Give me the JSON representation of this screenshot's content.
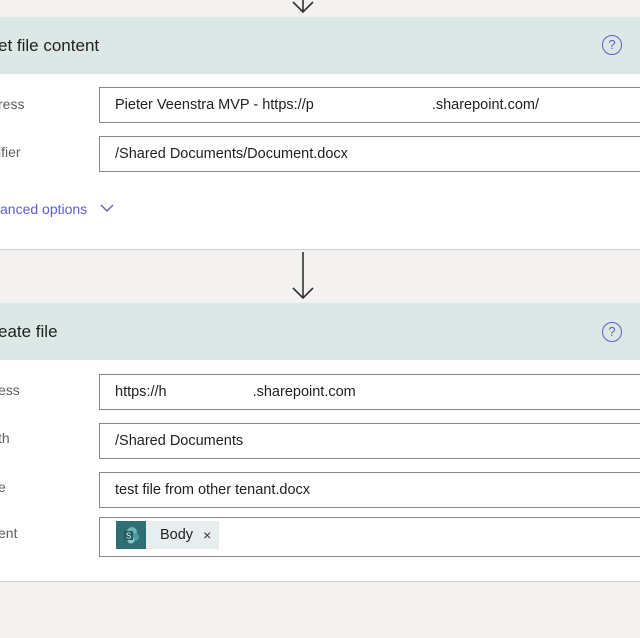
{
  "card1": {
    "title": "et file content",
    "help_glyph": "?",
    "fields": [
      {
        "label": "ress",
        "value_start": "Pieter Veenstra MVP - https://p",
        "value_end": ".sharepoint.com/"
      },
      {
        "label": "ifier",
        "value": "/Shared Documents/Document.docx"
      }
    ],
    "advanced_label": "anced options"
  },
  "card2": {
    "title": "eate file",
    "help_glyph": "?",
    "fields": [
      {
        "label": "ess",
        "value_start": "https://h",
        "value_end": ".sharepoint.com"
      },
      {
        "label": "th",
        "value": "/Shared Documents"
      },
      {
        "label": "e",
        "value": "test file from other tenant.docx"
      },
      {
        "label": "ent",
        "token": {
          "label": "Body",
          "remove": "×",
          "icon": "sharepoint-icon"
        }
      }
    ]
  },
  "icons": {
    "dropdown": "chevron-down-icon",
    "clear": "close-icon",
    "arrow": "arrow-down-icon"
  },
  "colors": {
    "header_bg": "#dce8e6",
    "accent": "#5b5fc7",
    "token_icon_bg": "#2f6f73"
  }
}
